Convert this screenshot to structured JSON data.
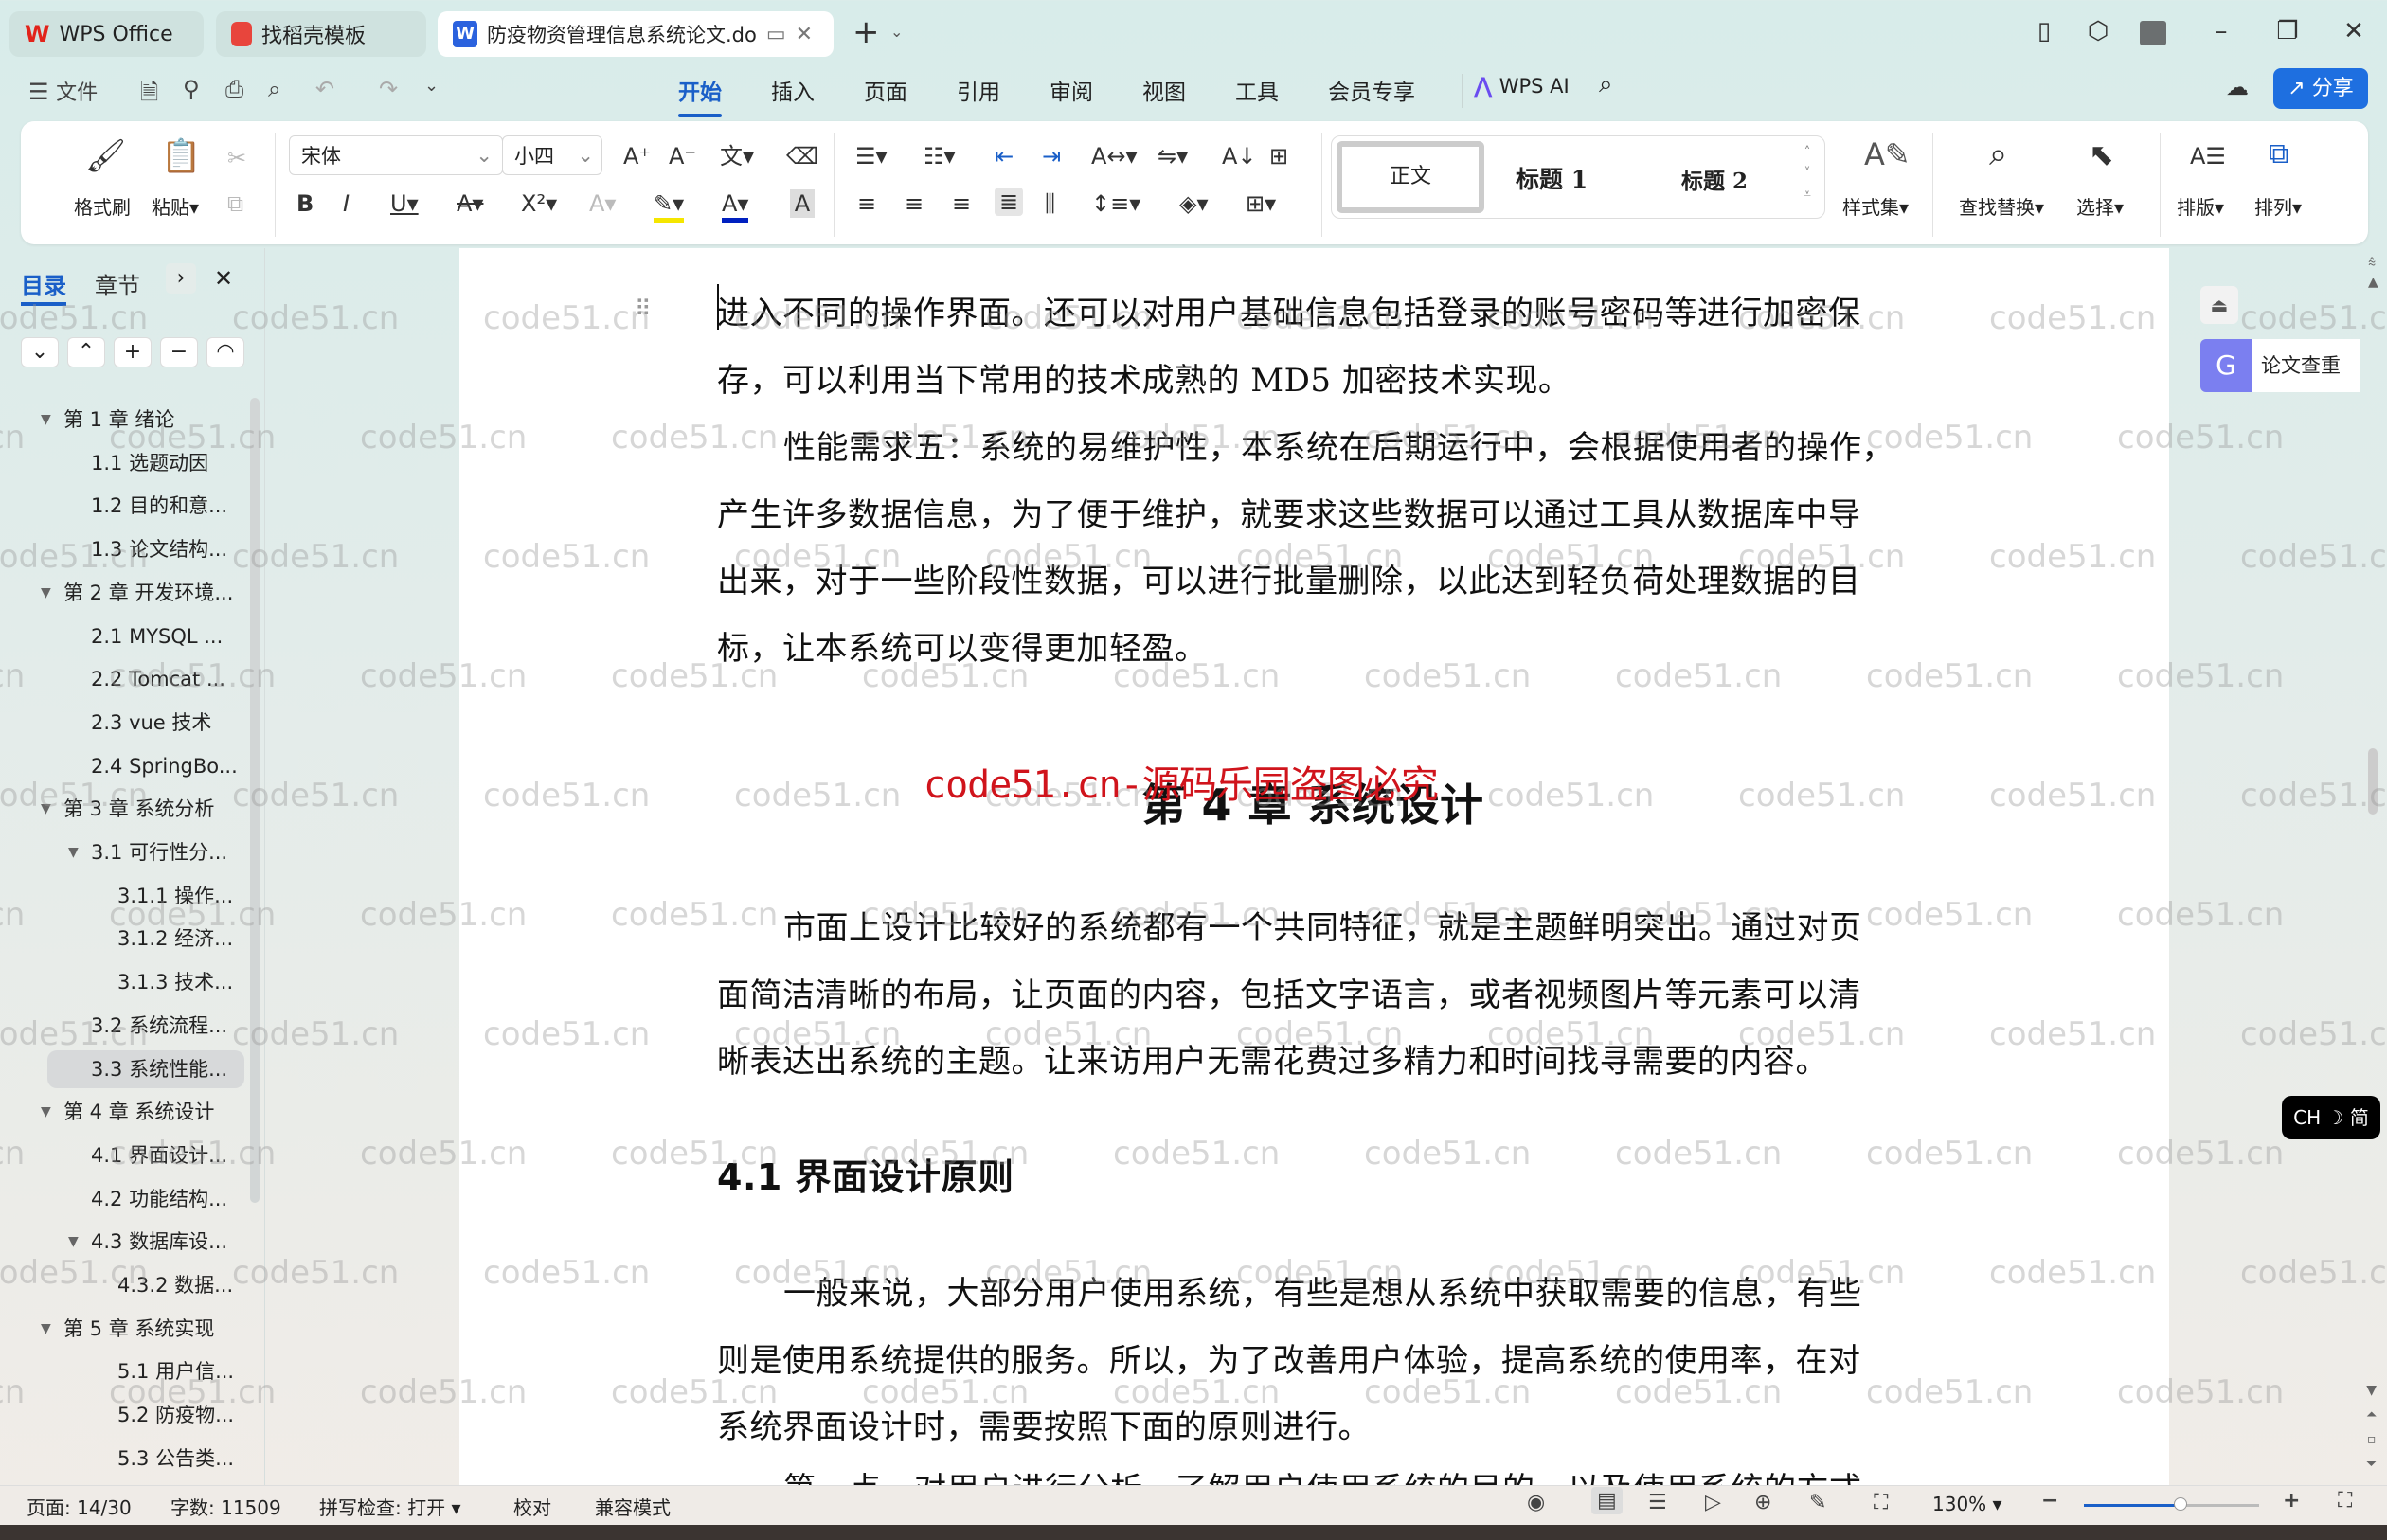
{
  "titlebar": {
    "tabs": [
      {
        "label": "WPS Office",
        "icon": "wps-logo-icon"
      },
      {
        "label": "找稻壳模板",
        "icon": "docer-icon"
      },
      {
        "label": "防疫物资管理信息系统论文.do",
        "icon": "word-doc-icon",
        "active": true
      }
    ],
    "new_tab": "+"
  },
  "menubar": {
    "file": "文件",
    "tabs": [
      "开始",
      "插入",
      "页面",
      "引用",
      "审阅",
      "视图",
      "工具",
      "会员专享"
    ],
    "active_tab": "开始",
    "wps_ai": "WPS AI",
    "share": "分享"
  },
  "ribbon": {
    "format_painter": "格式刷",
    "paste": "粘贴",
    "font_name": "宋体",
    "font_size": "小四",
    "styles": [
      "正文",
      "标题 1",
      "标题 2"
    ],
    "style_set": "样式集",
    "find_replace": "查找替换",
    "select": "选择",
    "layout": "排版",
    "arrange": "排列"
  },
  "sidebar": {
    "tabs": [
      "目录",
      "章节"
    ],
    "active_tab": "目录",
    "items": [
      {
        "label": "第 1 章  绪论",
        "level": 0,
        "expanded": true
      },
      {
        "label": "1.1 选题动因",
        "level": 1
      },
      {
        "label": "1.2 目的和意...",
        "level": 1
      },
      {
        "label": "1.3 论文结构...",
        "level": 1
      },
      {
        "label": "第 2 章  开发环境...",
        "level": 0,
        "expanded": true
      },
      {
        "label": "2.1 MYSQL ...",
        "level": 1
      },
      {
        "label": "2.2 Tomcat ...",
        "level": 1
      },
      {
        "label": "2.3 vue 技术",
        "level": 1
      },
      {
        "label": "2.4 SpringBo...",
        "level": 1
      },
      {
        "label": "第 3 章  系统分析",
        "level": 0,
        "expanded": true
      },
      {
        "label": "3.1 可行性分...",
        "level": 1,
        "expanded": true
      },
      {
        "label": "3.1.1 操作...",
        "level": 2
      },
      {
        "label": "3.1.2 经济...",
        "level": 2
      },
      {
        "label": "3.1.3 技术...",
        "level": 2
      },
      {
        "label": "3.2 系统流程...",
        "level": 1
      },
      {
        "label": "3.3 系统性能...",
        "level": 1,
        "selected": true
      },
      {
        "label": "第 4 章  系统设计",
        "level": 0,
        "expanded": true
      },
      {
        "label": "4.1 界面设计...",
        "level": 1
      },
      {
        "label": "4.2 功能结构...",
        "level": 1
      },
      {
        "label": "4.3 数据库设...",
        "level": 1,
        "expanded": true
      },
      {
        "label": "4.3.2  数据...",
        "level": 2
      },
      {
        "label": "第 5 章  系统实现",
        "level": 0,
        "expanded": true
      },
      {
        "label": "5.1 用户信...",
        "level": 2
      },
      {
        "label": "5.2  防疫物...",
        "level": 2
      },
      {
        "label": "5.3 公告类...",
        "level": 2
      }
    ]
  },
  "document": {
    "para1": [
      "进入不同的操作界面。还可以对用户基础信息包括登录的账号密码等进行加密保",
      "存，可以利用当下常用的技术成熟的 MD5 加密技术实现。"
    ],
    "para2": [
      "性能需求五：系统的易维护性，本系统在后期运行中，会根据使用者的操作，",
      "产生许多数据信息，为了便于维护，就要求这些数据可以通过工具从数据库中导",
      "出来，对于一些阶段性数据，可以进行批量删除，以此达到轻负荷处理数据的目",
      "标，让本系统可以变得更加轻盈。"
    ],
    "chapter_heading": "第 4 章  系统设计",
    "para3": [
      "市面上设计比较好的系统都有一个共同特征，就是主题鲜明突出。通过对页",
      "面简洁清晰的布局，让页面的内容，包括文字语言，或者视频图片等元素可以清",
      "晰表达出系统的主题。让来访用户无需花费过多精力和时间找寻需要的内容。"
    ],
    "section_heading": "4.1 界面设计原则",
    "para4": [
      "一般来说，大部分用户使用系统，有些是想从系统中获取需要的信息，有些",
      "则是使用系统提供的服务。所以，为了改善用户体验，提高系统的使用率，在对",
      "系统界面设计时，需要按照下面的原则进行。"
    ],
    "para5_partial": "第一点，对用户进行分析，了解用户使用系统的目的，以及使用系统的方式",
    "red_watermark": "code51.cn-源码乐园盗图必究"
  },
  "watermark": "code51.cn",
  "right_panel": {
    "paper_check": "论文查重",
    "ime": "CH ☽ 简"
  },
  "statusbar": {
    "page": "页面: 14/30",
    "word_count": "字数: 11509",
    "spell_check": "拼写检查: 打开",
    "proofread": "校对",
    "compat_mode": "兼容模式",
    "zoom": "130%",
    "zoom_slider_fraction": 0.55
  },
  "colors": {
    "accent": "#1a5fc8",
    "share_button": "#1e6fe0",
    "red_watermark": "#d0141c",
    "paper_check": "#7b7ff0"
  }
}
